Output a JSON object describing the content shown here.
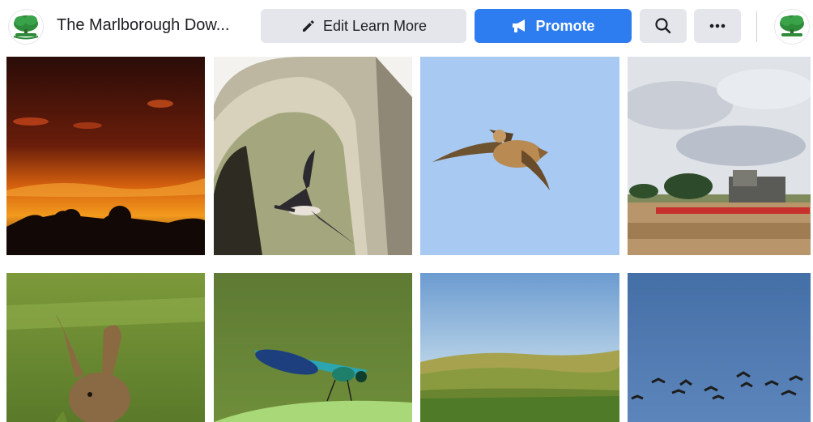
{
  "header": {
    "page_name": "The Marlborough Dow...",
    "edit_button_label": "Edit Learn More",
    "promote_button_label": "Promote",
    "pencil_icon": "pencil-icon",
    "megaphone_icon": "megaphone-icon",
    "search_icon": "search-icon",
    "more_icon": "more-horizontal-icon"
  },
  "colors": {
    "promote_blue": "#2d7cf0",
    "button_gray": "#e4e6eb",
    "logo_green": "#2e8b3a"
  },
  "photos": [
    "sunset-photo",
    "swallow-photo",
    "kestrel-photo",
    "harvester-photo",
    "hare-photo",
    "damselfly-photo",
    "downs-landscape-photo",
    "birds-flock-photo"
  ]
}
